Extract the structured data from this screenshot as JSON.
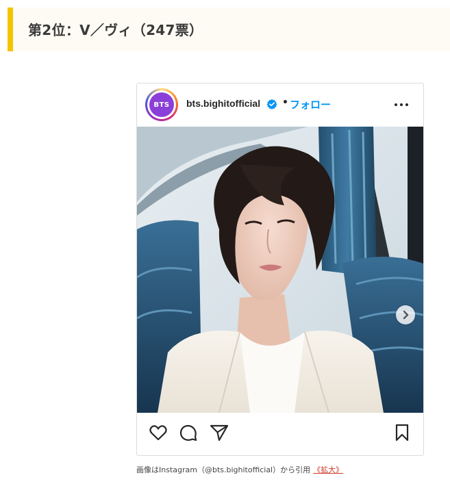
{
  "section": {
    "heading": "第2位：V／ヴィ（247票）"
  },
  "post": {
    "avatar_text": "BTS",
    "username": "bts.bighitofficial",
    "separator": "•",
    "follow_label": "フォロー"
  },
  "caption": {
    "text": "画像はInstagram（@bts.bighitofficial）から引用",
    "link_label": "《拡大》"
  },
  "colors": {
    "accent_bar": "#f5c400",
    "follow_blue": "#0095f6",
    "link_red": "#cc3b2a",
    "avatar_purple": "#8a3fd8"
  },
  "icons": [
    "verified-icon",
    "more-options-icon",
    "next-arrow-icon",
    "heart-icon",
    "comment-icon",
    "share-icon",
    "bookmark-icon"
  ]
}
